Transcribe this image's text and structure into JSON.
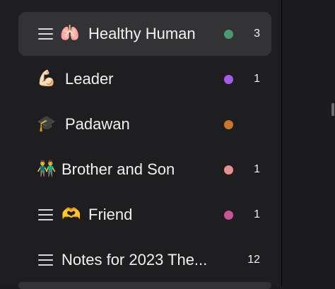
{
  "sidebar": {
    "items": [
      {
        "label": "Healthy Human",
        "emoji": "🫁",
        "emoji_name": "lungs-icon",
        "has_menu_icon": true,
        "dot_color": "#4a9a6c",
        "count": "3",
        "selected": true
      },
      {
        "label": "Leader",
        "emoji": "💪🏻",
        "emoji_name": "flexed-biceps-icon",
        "has_menu_icon": false,
        "dot_color": "#a35ee6",
        "count": "1",
        "selected": false
      },
      {
        "label": "Padawan",
        "emoji": "🎓",
        "emoji_name": "graduation-cap-icon",
        "has_menu_icon": false,
        "dot_color": "#c7782a",
        "count": "",
        "selected": false
      },
      {
        "label": "Brother and Son",
        "emoji": "👬",
        "emoji_name": "family-icon",
        "has_menu_icon": false,
        "dot_color": "#e4918b",
        "count": "1",
        "selected": false
      },
      {
        "label": "Friend",
        "emoji": "🫶",
        "emoji_name": "heart-hands-icon",
        "has_menu_icon": true,
        "dot_color": "#c9549a",
        "count": "1",
        "selected": false
      },
      {
        "label": "Notes for 2023 The...",
        "emoji": "",
        "emoji_name": "",
        "has_menu_icon": true,
        "dot_color": "",
        "count": "12",
        "selected": false
      }
    ]
  }
}
